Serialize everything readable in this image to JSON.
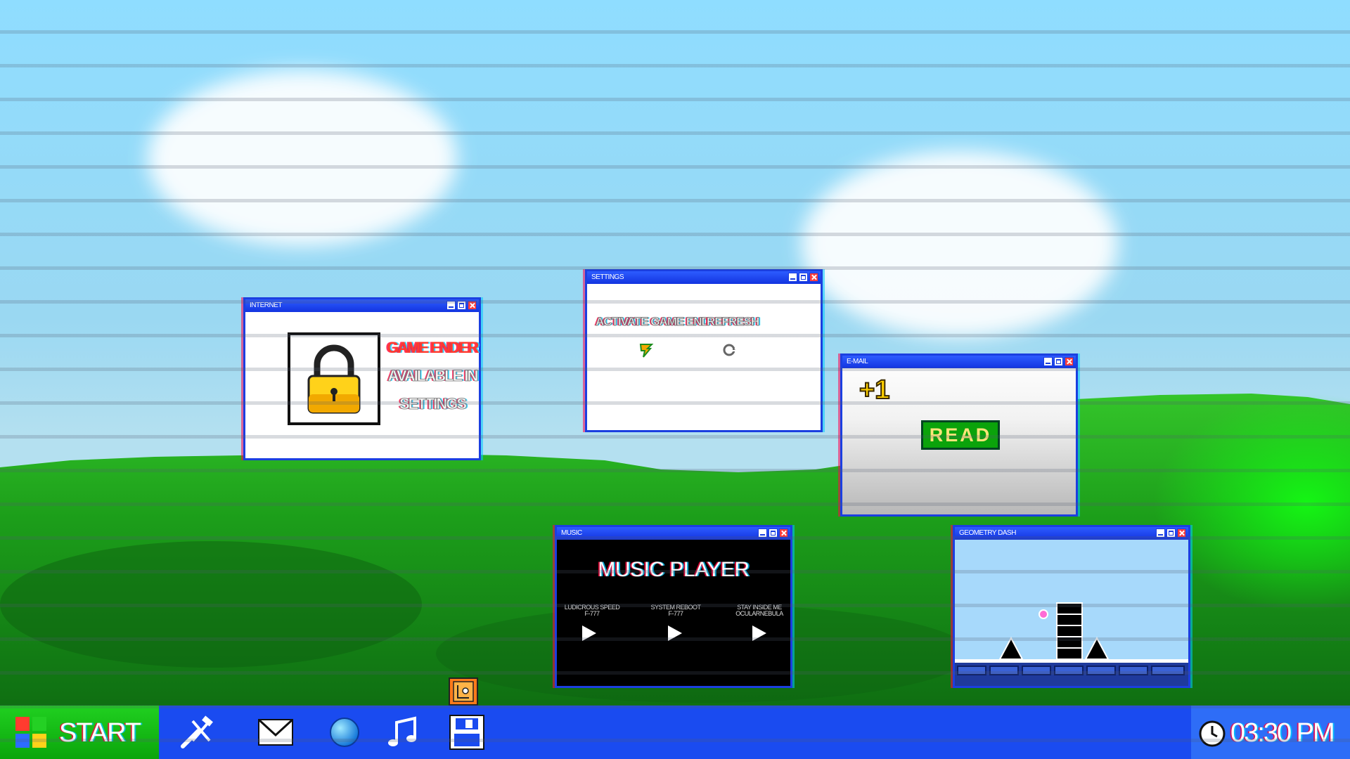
{
  "windows": {
    "internet": {
      "title": "INTERNET",
      "lines": [
        "GAME ENDER",
        "AVAILABLE IN",
        "SETTINGS"
      ]
    },
    "settings": {
      "title": "SETTINGS",
      "activate_label": "ACTIVATE GAME END",
      "refresh_label": "REFRESH"
    },
    "email": {
      "title": "E-MAIL",
      "count": "+1",
      "read_label": "READ"
    },
    "music": {
      "title": "MUSIC",
      "heading": "MUSIC PLAYER",
      "tracks": [
        {
          "name": "LUDICROUS SPEED",
          "artist": "F-777"
        },
        {
          "name": "SYSTEM REBOOT",
          "artist": "F-777"
        },
        {
          "name": "STAY INSIDE ME",
          "artist": "OCULARNEBULA"
        }
      ]
    },
    "geometry_dash": {
      "title": "GEOMETRY DASH"
    }
  },
  "taskbar": {
    "start_label": "START",
    "apps": [
      "tools-icon",
      "mail-icon",
      "globe-icon",
      "music-note-icon",
      "floppy-disk-icon"
    ],
    "clock_time": "03:30 PM"
  },
  "colors": {
    "taskbar": "#1a4bf0",
    "start": "#0ba50b",
    "window_border": "#1b3fe0",
    "game_ender_text": "#ff3b2f"
  }
}
